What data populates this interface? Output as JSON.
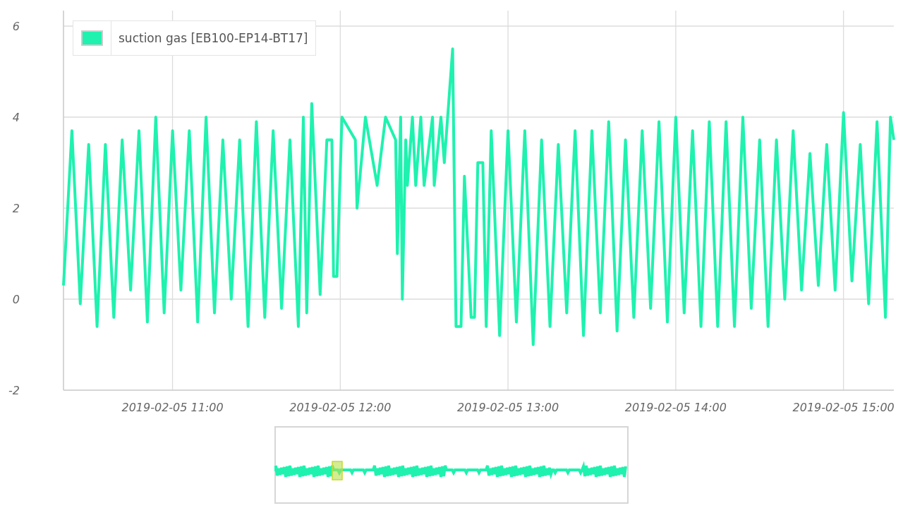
{
  "chart_data": {
    "type": "line",
    "x": [
      "2019-02-05 10:21:00",
      "2019-02-05 10:24:00",
      "2019-02-05 10:27:00",
      "2019-02-05 10:30:00",
      "2019-02-05 10:33:00",
      "2019-02-05 10:36:00",
      "2019-02-05 10:39:00",
      "2019-02-05 10:42:00",
      "2019-02-05 10:45:00",
      "2019-02-05 10:48:00",
      "2019-02-05 10:51:00",
      "2019-02-05 10:54:00",
      "2019-02-05 10:57:00",
      "2019-02-05 11:00:00",
      "2019-02-05 11:03:00",
      "2019-02-05 11:06:00",
      "2019-02-05 11:09:00",
      "2019-02-05 11:12:00",
      "2019-02-05 11:15:00",
      "2019-02-05 11:18:00",
      "2019-02-05 11:21:00",
      "2019-02-05 11:24:00",
      "2019-02-05 11:27:00",
      "2019-02-05 11:30:00",
      "2019-02-05 11:33:00",
      "2019-02-05 11:36:00",
      "2019-02-05 11:39:00",
      "2019-02-05 11:42:00",
      "2019-02-05 11:45:00",
      "2019-02-05 11:46:48",
      "2019-02-05 11:48:00",
      "2019-02-05 11:49:48",
      "2019-02-05 11:52:48",
      "2019-02-05 11:55:12",
      "2019-02-05 11:57:00",
      "2019-02-05 11:57:36",
      "2019-02-05 11:58:48",
      "2019-02-05 12:00:36",
      "2019-02-05 12:05:24",
      "2019-02-05 12:06:00",
      "2019-02-05 12:09:00",
      "2019-02-05 12:13:12",
      "2019-02-05 12:16:12",
      "2019-02-05 12:19:48",
      "2019-02-05 12:20:24",
      "2019-02-05 12:21:36",
      "2019-02-05 12:22:12",
      "2019-02-05 12:23:24",
      "2019-02-05 12:24:00",
      "2019-02-05 12:25:48",
      "2019-02-05 12:27:00",
      "2019-02-05 12:28:48",
      "2019-02-05 12:30:00",
      "2019-02-05 12:33:00",
      "2019-02-05 12:33:36",
      "2019-02-05 12:36:00",
      "2019-02-05 12:37:12",
      "2019-02-05 12:40:12",
      "2019-02-05 12:41:24",
      "2019-02-05 12:43:12",
      "2019-02-05 12:44:24",
      "2019-02-05 12:46:48",
      "2019-02-05 12:48:00",
      "2019-02-05 12:49:12",
      "2019-02-05 12:51:00",
      "2019-02-05 12:52:12",
      "2019-02-05 12:54:00",
      "2019-02-05 12:57:00",
      "2019-02-05 13:00:00",
      "2019-02-05 13:03:00",
      "2019-02-05 13:06:00",
      "2019-02-05 13:09:00",
      "2019-02-05 13:12:00",
      "2019-02-05 13:15:00",
      "2019-02-05 13:18:00",
      "2019-02-05 13:21:00",
      "2019-02-05 13:24:00",
      "2019-02-05 13:27:00",
      "2019-02-05 13:30:00",
      "2019-02-05 13:33:00",
      "2019-02-05 13:36:00",
      "2019-02-05 13:39:00",
      "2019-02-05 13:42:00",
      "2019-02-05 13:45:00",
      "2019-02-05 13:48:00",
      "2019-02-05 13:51:00",
      "2019-02-05 13:54:00",
      "2019-02-05 13:57:00",
      "2019-02-05 14:00:00",
      "2019-02-05 14:03:00",
      "2019-02-05 14:06:00",
      "2019-02-05 14:09:00",
      "2019-02-05 14:12:00",
      "2019-02-05 14:15:00",
      "2019-02-05 14:18:00",
      "2019-02-05 14:21:00",
      "2019-02-05 14:24:00",
      "2019-02-05 14:27:00",
      "2019-02-05 14:30:00",
      "2019-02-05 14:33:00",
      "2019-02-05 14:36:00",
      "2019-02-05 14:39:00",
      "2019-02-05 14:42:00",
      "2019-02-05 14:45:00",
      "2019-02-05 14:48:00",
      "2019-02-05 14:51:00",
      "2019-02-05 14:54:00",
      "2019-02-05 14:57:00",
      "2019-02-05 15:00:00",
      "2019-02-05 15:03:00",
      "2019-02-05 15:06:00",
      "2019-02-05 15:09:00",
      "2019-02-05 15:12:00",
      "2019-02-05 15:15:00",
      "2019-02-05 15:16:48",
      "2019-02-05 15:18:00"
    ],
    "series": [
      {
        "name": "suction gas [EB100-EP14-BT17]",
        "color": "#1ef2ae",
        "values": [
          0.3,
          3.7,
          -0.1,
          3.4,
          -0.6,
          3.4,
          -0.4,
          3.5,
          0.2,
          3.7,
          -0.5,
          4.0,
          -0.3,
          3.7,
          0.2,
          3.7,
          -0.5,
          4.0,
          -0.3,
          3.5,
          0.0,
          3.5,
          -0.6,
          3.9,
          -0.4,
          3.7,
          -0.2,
          3.5,
          -0.6,
          4.0,
          -0.3,
          4.3,
          0.1,
          3.5,
          3.5,
          0.5,
          0.5,
          4.0,
          3.5,
          2.0,
          4.0,
          2.5,
          4.0,
          3.5,
          1.0,
          4.0,
          0.0,
          3.5,
          2.5,
          4.0,
          2.5,
          4.0,
          2.5,
          4.0,
          2.5,
          4.0,
          3.0,
          5.5,
          -0.6,
          -0.6,
          2.7,
          -0.4,
          -0.4,
          3.0,
          3.0,
          -0.6,
          3.7,
          -0.8,
          3.7,
          -0.5,
          3.7,
          -1.0,
          3.5,
          -0.6,
          3.4,
          -0.3,
          3.7,
          -0.8,
          3.7,
          -0.3,
          3.9,
          -0.7,
          3.5,
          -0.4,
          3.7,
          -0.2,
          3.9,
          -0.5,
          4.0,
          -0.3,
          3.7,
          -0.6,
          3.9,
          -0.6,
          3.9,
          -0.6,
          4.0,
          -0.2,
          3.5,
          -0.6,
          3.5,
          0.0,
          3.7,
          0.2,
          3.2,
          0.3,
          3.4,
          0.2,
          4.1,
          0.4,
          3.4,
          -0.1,
          3.9,
          -0.4,
          4.0,
          3.5
        ]
      }
    ],
    "xlim": [
      "2019-02-05 10:21:00",
      "2019-02-05 15:18:00"
    ],
    "ylim": [
      -2,
      6
    ],
    "xticks": [
      "2019-02-05 11:00",
      "2019-02-05 12:00",
      "2019-02-05 13:00",
      "2019-02-05 14:00",
      "2019-02-05 15:00"
    ],
    "yticks": [
      -2,
      0,
      2,
      4,
      6
    ],
    "grid": true
  }
}
